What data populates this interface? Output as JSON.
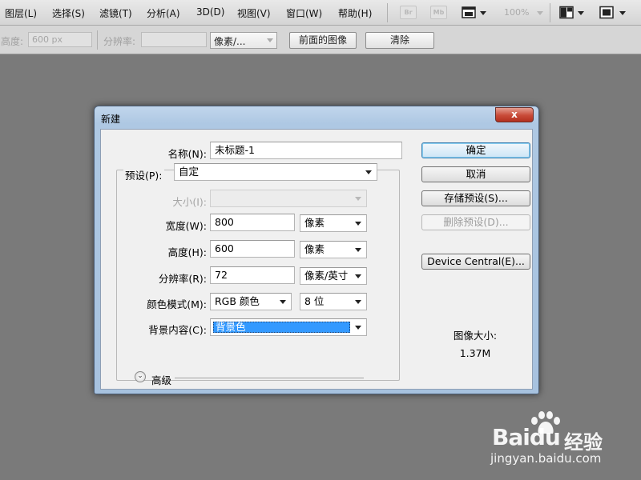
{
  "menubar": {
    "items": [
      "图层(L)",
      "选择(S)",
      "滤镜(T)",
      "分析(A)",
      "3D(D)",
      "视图(V)",
      "窗口(W)",
      "帮助(H)"
    ],
    "bridge_icon": "Br",
    "minibridge_icon": "Mb",
    "zoom": "100%"
  },
  "options": {
    "height_label": "高度:",
    "height_value": "600 px",
    "resolution_label": "分辨率:",
    "resolution_value": "",
    "unit_select": "像素/...",
    "front_image_button": "前面的图像",
    "clear_button": "清除"
  },
  "dialog": {
    "title": "新建",
    "close_label": "x",
    "name_label": "名称(N):",
    "name_value": "未标题-1",
    "preset_label": "预设(P):",
    "preset_value": "自定",
    "size_label": "大小(I):",
    "size_value": "",
    "width_label": "宽度(W):",
    "width_value": "800",
    "width_unit": "像素",
    "height_label": "高度(H):",
    "height_value": "600",
    "height_unit": "像素",
    "resolution_label": "分辨率(R):",
    "resolution_value": "72",
    "resolution_unit": "像素/英寸",
    "color_mode_label": "颜色模式(M):",
    "color_mode_value": "RGB 颜色",
    "bit_depth_value": "8 位",
    "background_label": "背景内容(C):",
    "background_value": "背景色",
    "advanced_label": "高级",
    "buttons": {
      "ok": "确定",
      "cancel": "取消",
      "save_preset": "存储预设(S)...",
      "delete_preset": "删除预设(D)...",
      "device_central": "Device Central(E)..."
    },
    "image_size_label": "图像大小:",
    "image_size_value": "1.37M"
  },
  "watermark": {
    "brand": "Baidu",
    "brand_cn": "经验",
    "url": "jingyan.baidu.com"
  },
  "colors": {
    "canvas": "#7a7a7a",
    "highlight": "#3399ff",
    "close_button": "#c84a38"
  }
}
